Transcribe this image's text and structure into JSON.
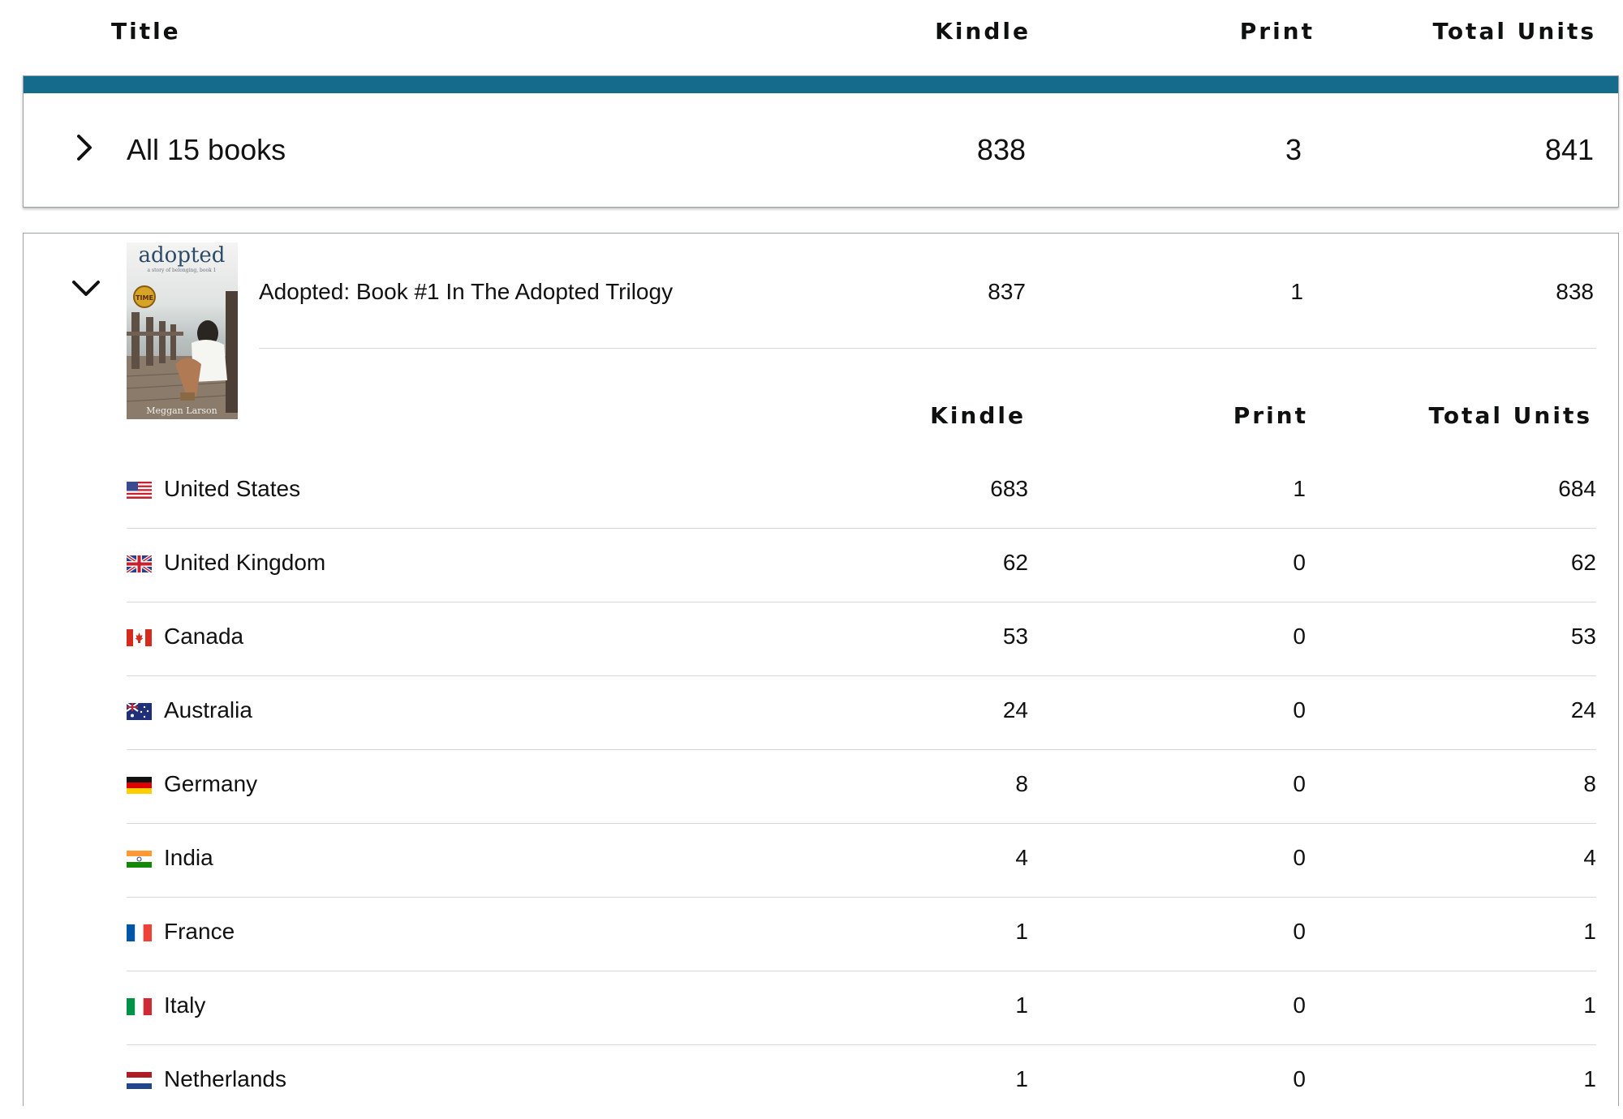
{
  "columns": {
    "title": "Title",
    "kindle": "Kindle",
    "print": "Print",
    "total": "Total Units"
  },
  "all_books": {
    "label": "All 15 books",
    "kindle": "838",
    "print": "3",
    "total": "841",
    "accent_color": "#146b8c"
  },
  "book": {
    "title": "Adopted: Book #1 In The Adopted Trilogy",
    "kindle": "837",
    "print": "1",
    "total": "838",
    "cover": {
      "title": "adopted",
      "tagline": "a story of belonging, book 1",
      "author": "Meggan Larson"
    }
  },
  "sub_columns": {
    "kindle": "Kindle",
    "print": "Print",
    "total": "Total Units"
  },
  "countries": [
    {
      "name": "United States",
      "kindle": "683",
      "print": "1",
      "total": "684",
      "flag": "us-flag-icon"
    },
    {
      "name": "United Kingdom",
      "kindle": "62",
      "print": "0",
      "total": "62",
      "flag": "uk-flag-icon"
    },
    {
      "name": "Canada",
      "kindle": "53",
      "print": "0",
      "total": "53",
      "flag": "ca-flag-icon"
    },
    {
      "name": "Australia",
      "kindle": "24",
      "print": "0",
      "total": "24",
      "flag": "au-flag-icon"
    },
    {
      "name": "Germany",
      "kindle": "8",
      "print": "0",
      "total": "8",
      "flag": "de-flag-icon"
    },
    {
      "name": "India",
      "kindle": "4",
      "print": "0",
      "total": "4",
      "flag": "in-flag-icon"
    },
    {
      "name": "France",
      "kindle": "1",
      "print": "0",
      "total": "1",
      "flag": "fr-flag-icon"
    },
    {
      "name": "Italy",
      "kindle": "1",
      "print": "0",
      "total": "1",
      "flag": "it-flag-icon"
    },
    {
      "name": "Netherlands",
      "kindle": "1",
      "print": "0",
      "total": "1",
      "flag": "nl-flag-icon"
    }
  ]
}
